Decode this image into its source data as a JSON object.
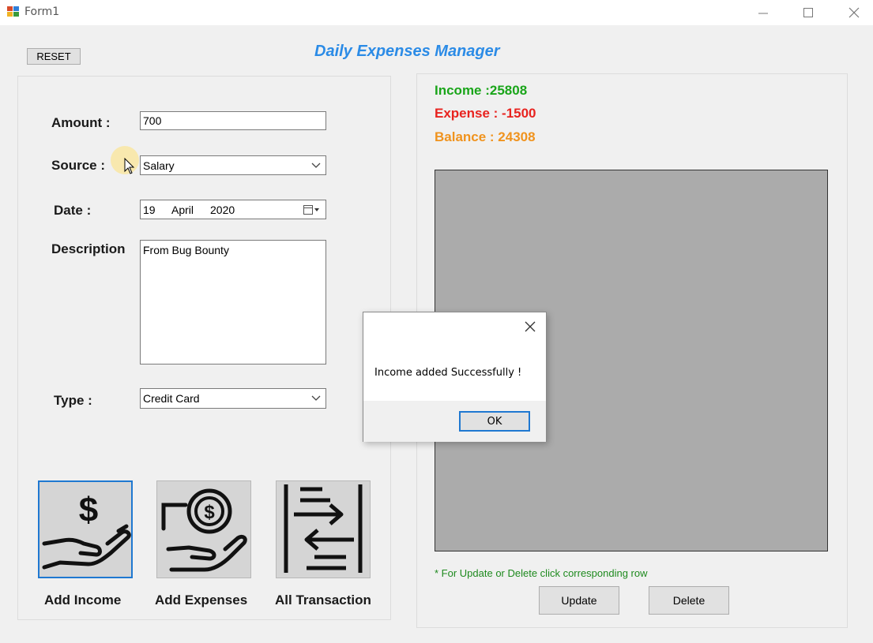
{
  "window": {
    "title": "Form1"
  },
  "header": {
    "reset_label": "RESET",
    "app_title": "Daily Expenses Manager"
  },
  "form": {
    "amount_label": "Amount :",
    "amount_value": "700",
    "source_label": "Source :",
    "source_value": "Salary",
    "date_label": "Date :",
    "date_day": "19",
    "date_month": "April",
    "date_year": "2020",
    "description_label": "Description",
    "description_value": "From Bug Bounty",
    "type_label": "Type :",
    "type_value": "Credit Card"
  },
  "actions": {
    "add_income": "Add Income",
    "add_expenses": "Add Expenses",
    "all_transaction": "All Transaction"
  },
  "summary": {
    "income": "Income :25808",
    "expense": "Expense : -1500",
    "balance": "Balance : 24308",
    "colors": {
      "income": "#1aa51a",
      "expense": "#e8231f",
      "balance": "#f0931e"
    }
  },
  "grid": {
    "hint": "* For Update or Delete click corresponding row",
    "update_label": "Update",
    "delete_label": "Delete"
  },
  "dialog": {
    "message": "Income added Successfully !",
    "ok_label": "OK"
  },
  "icons": [
    "app-icon",
    "minimize-icon",
    "maximize-icon",
    "close-icon",
    "chevron-down-icon",
    "calendar-icon",
    "dollar-hand-icon",
    "coin-hand-icon",
    "transfer-arrows-icon",
    "cursor-icon"
  ]
}
